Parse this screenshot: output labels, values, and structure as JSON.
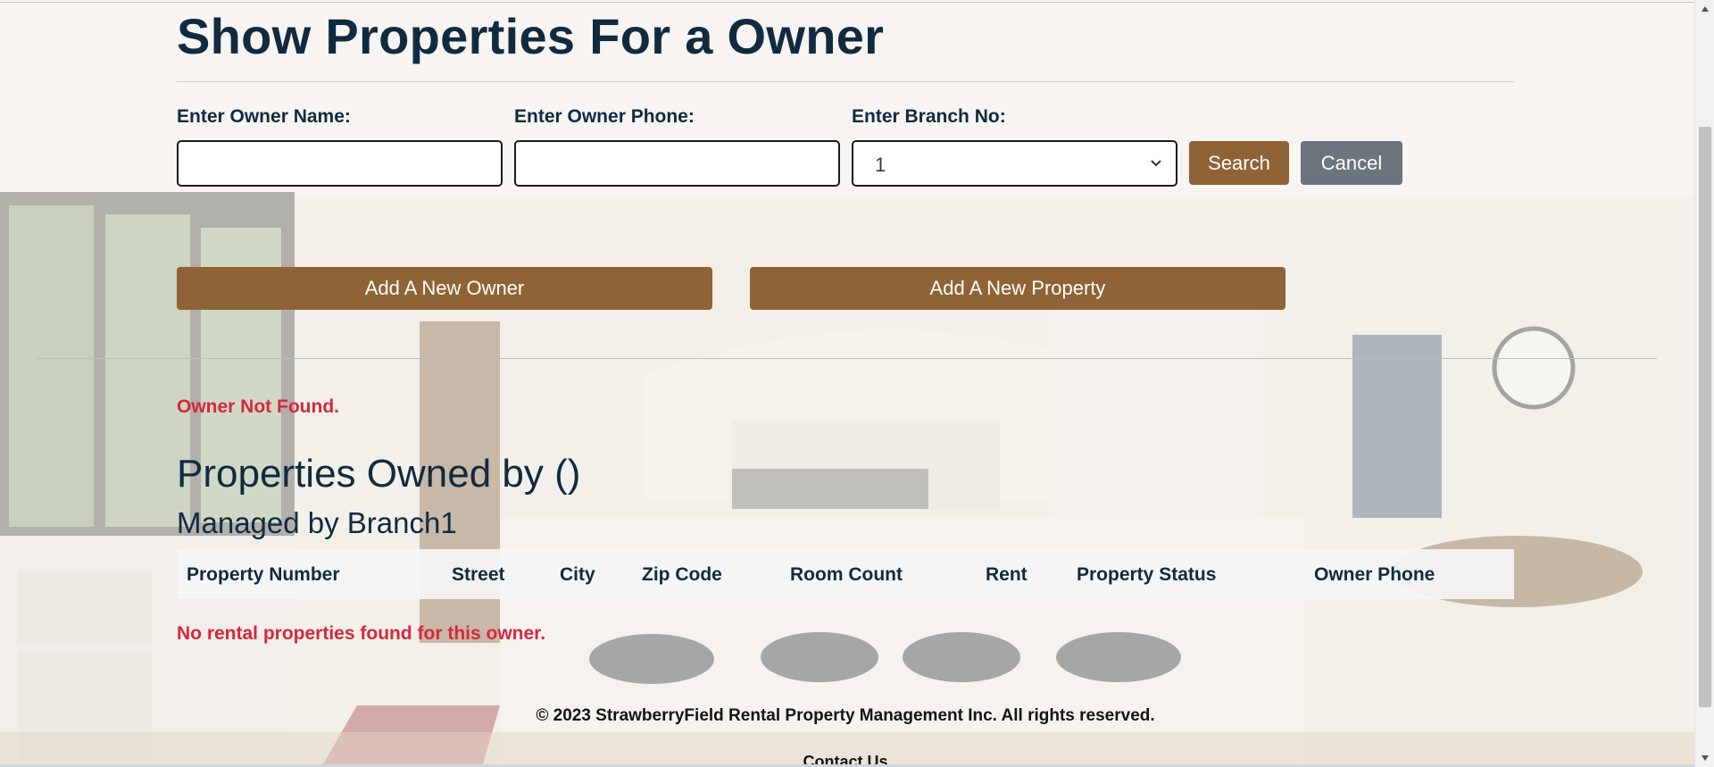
{
  "page": {
    "title": "Show Properties For a Owner"
  },
  "search_form": {
    "owner_name_label": "Enter Owner Name:",
    "owner_name_value": "",
    "owner_phone_label": "Enter Owner Phone:",
    "owner_phone_value": "",
    "branch_label": "Enter Branch No:",
    "branch_selected": "1",
    "search_button": "Search",
    "cancel_button": "Cancel"
  },
  "actions": {
    "add_owner_button": "Add A New Owner",
    "add_property_button": "Add A New Property"
  },
  "messages": {
    "owner_not_found": "Owner Not Found.",
    "no_properties": "No rental properties found for this owner."
  },
  "results": {
    "heading": "Properties Owned by ()",
    "subheading": "Managed by Branch1",
    "columns": [
      "Property Number",
      "Street",
      "City",
      "Zip Code",
      "Room Count",
      "Rent",
      "Property Status",
      "Owner Phone"
    ],
    "rows": []
  },
  "footer": {
    "copyright": "© 2023 StrawberryField Rental Property Management Inc. All rights reserved.",
    "contact": "Contact Us"
  },
  "colors": {
    "brand_brown": "#8f6336",
    "secondary_gray": "#6c757d",
    "error_red": "#d6283c",
    "heading_navy": "#102b3f"
  },
  "icons": {
    "select_caret": "chevron-down-icon",
    "scroll_up": "triangle-up-icon",
    "scroll_down": "triangle-down-icon"
  }
}
